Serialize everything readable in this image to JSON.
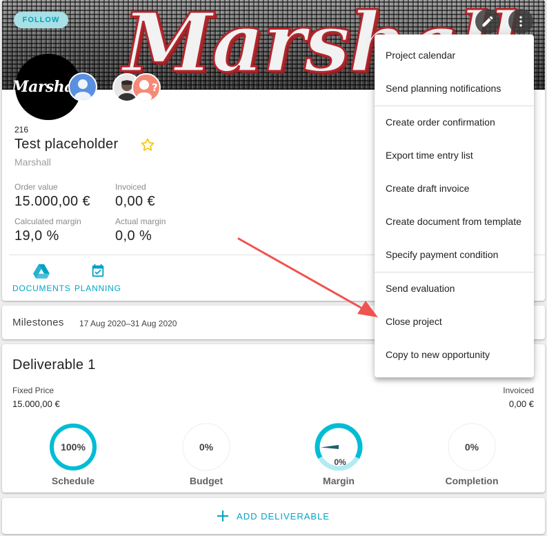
{
  "header": {
    "follow_label": "FOLLOW",
    "logo_text": "Marshall",
    "banner_text": "Marshall"
  },
  "project": {
    "number": "216",
    "title": "Test placeholder",
    "customer": "Marshall",
    "order_value_label": "Order value",
    "order_value": "15.000,00 €",
    "invoiced_label": "Invoiced",
    "invoiced": "0,00 €",
    "calc_margin_label": "Calculated margin",
    "calc_margin": "19,0 %",
    "actual_margin_label": "Actual margin",
    "actual_margin": "0,0 %"
  },
  "actions": {
    "documents_label": "DOCUMENTS",
    "planning_label": "PLANNING"
  },
  "milestones": {
    "title": "Milestones",
    "range": "17 Aug 2020–31 Aug 2020"
  },
  "deliverable": {
    "title": "Deliverable 1",
    "price_type": "Fixed Price",
    "price": "15.000,00 €",
    "invoiced_label": "Invoiced",
    "invoiced": "0,00 €",
    "gauges": [
      {
        "label": "Schedule",
        "value_text": "100%",
        "value": 1.0
      },
      {
        "label": "Budget",
        "value_text": "0%",
        "value": 0.0
      },
      {
        "label": "Margin",
        "value_text": "0%",
        "value": 0.0
      },
      {
        "label": "Completion",
        "value_text": "0%",
        "value": 0.0
      }
    ]
  },
  "add_deliverable_label": "ADD DELIVERABLE",
  "menu": {
    "items": [
      "Project calendar",
      "Send planning notifications",
      "Create order confirmation",
      "Export time entry list",
      "Create draft invoice",
      "Create document from template",
      "Specify payment condition",
      "Send evaluation",
      "Close project",
      "Copy to new opportunity"
    ]
  },
  "colors": {
    "accent": "#00a3c4",
    "gauge_track": "#b2ebf2",
    "arrow": "#ef5350",
    "star": "#f9c513"
  },
  "icons": [
    "pencil-icon",
    "more-vert-icon",
    "star-outline-icon",
    "google-drive-icon",
    "calendar-check-icon",
    "plus-icon",
    "person-icon",
    "person-question-icon"
  ]
}
